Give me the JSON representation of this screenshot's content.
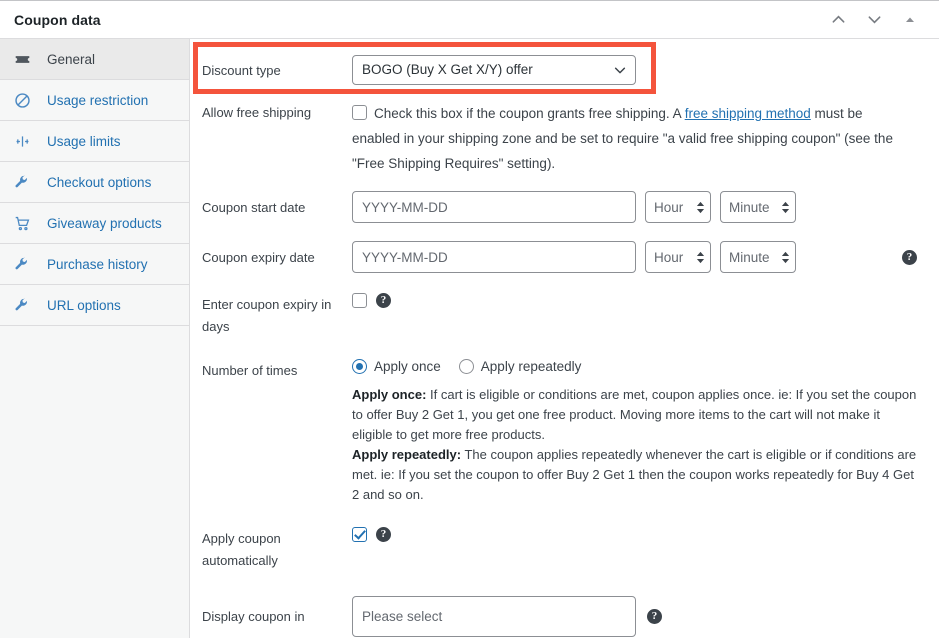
{
  "header": {
    "title": "Coupon data",
    "actions": [
      {
        "name": "move-up-icon",
        "glyph": "chevron-up"
      },
      {
        "name": "move-down-icon",
        "glyph": "chevron-down"
      },
      {
        "name": "toggle-panel-icon",
        "glyph": "triangle-up"
      }
    ]
  },
  "sidebar": {
    "items": [
      {
        "label": "General",
        "icon": "ticket-icon",
        "active": true
      },
      {
        "label": "Usage restriction",
        "icon": "ban-icon",
        "active": false
      },
      {
        "label": "Usage limits",
        "icon": "limits-icon",
        "active": false
      },
      {
        "label": "Checkout options",
        "icon": "wrench-icon",
        "active": false
      },
      {
        "label": "Giveaway products",
        "icon": "cart-icon",
        "active": false
      },
      {
        "label": "Purchase history",
        "icon": "wrench-icon",
        "active": false
      },
      {
        "label": "URL options",
        "icon": "wrench-icon",
        "active": false
      }
    ]
  },
  "form": {
    "discount_type": {
      "label": "Discount type",
      "value": "BOGO (Buy X Get X/Y) offer",
      "highlighted": true,
      "highlight_color": "#f4543c"
    },
    "free_shipping": {
      "label": "Allow free shipping",
      "checked": false,
      "desc_before": "Check this box if the coupon grants free shipping. A ",
      "link_text": "free shipping method",
      "desc_after": " must be enabled in your shipping zone and be set to require \"a valid free shipping coupon\" (see the \"Free Shipping Requires\" setting)."
    },
    "start_date": {
      "label": "Coupon start date",
      "placeholder": "YYYY-MM-DD",
      "value": "",
      "hour_placeholder": "Hour",
      "minute_placeholder": "Minute"
    },
    "expiry_date": {
      "label": "Coupon expiry date",
      "placeholder": "YYYY-MM-DD",
      "value": "",
      "hour_placeholder": "Hour",
      "minute_placeholder": "Minute",
      "help": "?"
    },
    "expiry_in_days": {
      "label": "Enter coupon expiry in days",
      "checked": false,
      "help": "?"
    },
    "number_of_times": {
      "label": "Number of times",
      "options": [
        {
          "label": "Apply once",
          "selected": true
        },
        {
          "label": "Apply repeatedly",
          "selected": false
        }
      ],
      "desc_once_title": "Apply once:",
      "desc_once_body": " If cart is eligible or conditions are met, coupon applies once. ie: If you set the coupon to offer Buy 2 Get 1, you get one free product. Moving more items to the cart will not make it eligible to get more free products.",
      "desc_rep_title": "Apply repeatedly:",
      "desc_rep_body": " The coupon applies repeatedly whenever the cart is eligible or if conditions are met. ie: If you set the coupon to offer Buy 2 Get 1 then the coupon works repeatedly for Buy 4 Get 2 and so on."
    },
    "apply_automatically": {
      "label": "Apply coupon automatically",
      "checked": true,
      "help": "?"
    },
    "display_coupon_in": {
      "label": "Display coupon in",
      "placeholder": "Please select",
      "value": "",
      "help": "?"
    }
  }
}
